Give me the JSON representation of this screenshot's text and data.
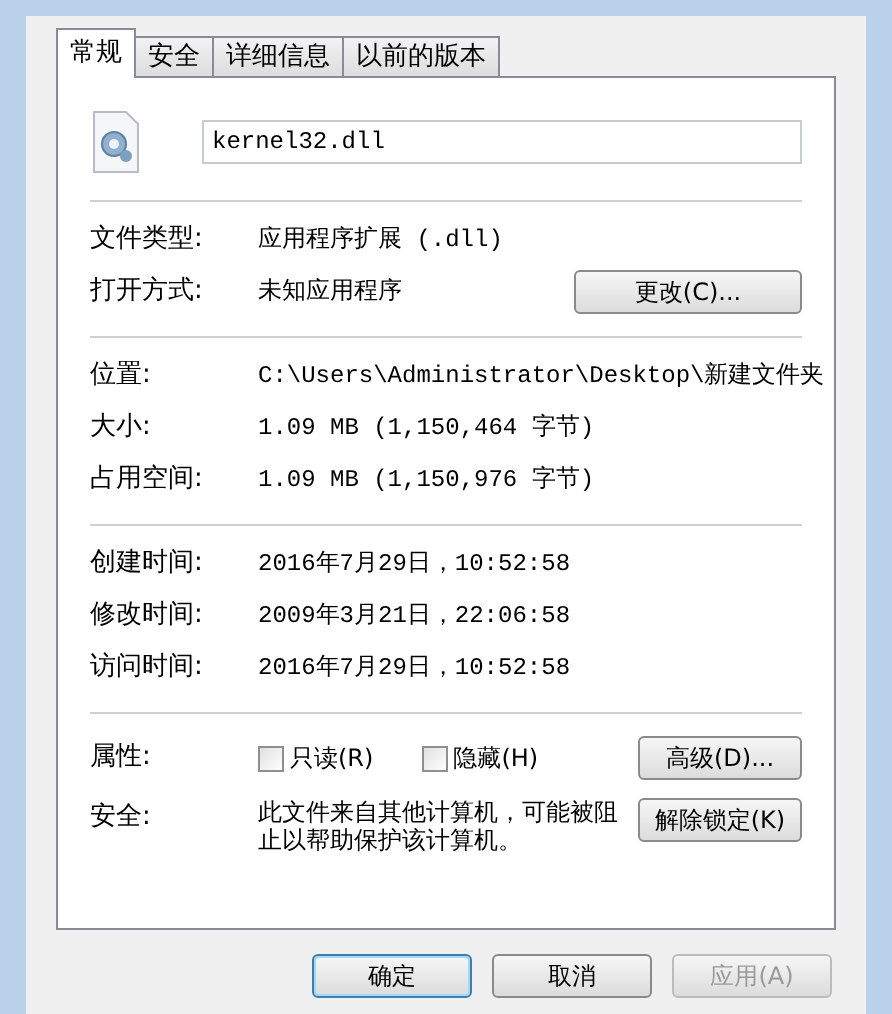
{
  "tabs": [
    {
      "label": "常规",
      "selected": true
    },
    {
      "label": "安全",
      "selected": false
    },
    {
      "label": "详细信息",
      "selected": false
    },
    {
      "label": "以前的版本",
      "selected": false
    }
  ],
  "file_name": {
    "value": "kernel32.dll"
  },
  "groups": [
    {
      "rows": [
        {
          "label": "文件类型:",
          "value": "应用程序扩展 (.dll)"
        },
        {
          "label": "打开方式:",
          "value": "未知应用程序",
          "button": "更改(C)..."
        }
      ]
    },
    {
      "rows": [
        {
          "label": "位置:",
          "value": "C:\\Users\\Administrator\\Desktop\\新建文件夹"
        },
        {
          "label": "大小:",
          "value": "1.09 MB (1,150,464 字节)"
        },
        {
          "label": "占用空间:",
          "value": "1.09 MB (1,150,976 字节)"
        }
      ]
    },
    {
      "rows": [
        {
          "label": "创建时间:",
          "value": "2016年7月29日，10:52:58"
        },
        {
          "label": "修改时间:",
          "value": "2009年3月21日，22:06:58"
        },
        {
          "label": "访问时间:",
          "value": "2016年7月29日，10:52:58"
        }
      ]
    }
  ],
  "attributes": {
    "label": "属性:",
    "checkboxes": [
      {
        "label": "只读(R)",
        "checked": false
      },
      {
        "label": "隐藏(H)",
        "checked": false
      }
    ],
    "button": "高级(D)..."
  },
  "security": {
    "label": "安全:",
    "text": "此文件来自其他计算机，可能被阻止以帮助保护该计算机。",
    "button": "解除锁定(K)"
  },
  "buttons": [
    {
      "label": "确定",
      "default": true,
      "disabled": false
    },
    {
      "label": "取消",
      "default": false,
      "disabled": false
    },
    {
      "label": "应用(A)",
      "default": false,
      "disabled": true
    }
  ]
}
